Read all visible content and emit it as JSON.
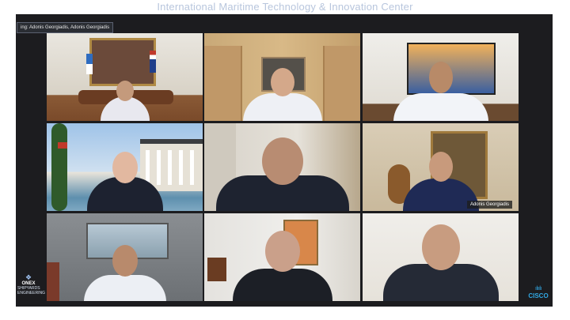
{
  "banner": {
    "title": "International Maritime Technology & Innovation Center"
  },
  "meeting": {
    "speaking_label": "ing: Adonis Georgiadis, Adonis Georgiadis"
  },
  "tiles": [
    {
      "id": 1,
      "name": ""
    },
    {
      "id": 2,
      "name": ""
    },
    {
      "id": 3,
      "name": ""
    },
    {
      "id": 4,
      "name": ""
    },
    {
      "id": 5,
      "name": ""
    },
    {
      "id": 6,
      "name": "Adonis Georgiadis"
    },
    {
      "id": 7,
      "name": ""
    },
    {
      "id": 8,
      "name": ""
    },
    {
      "id": 9,
      "name": ""
    }
  ],
  "branding": {
    "left_logo_glyph": "❖",
    "left_logo_name": "ONEX",
    "left_logo_sub1": "SHIPYARDS",
    "left_logo_sub2": "ENGINEERING",
    "right_logo_bars": "ılıılı",
    "right_logo_name": "CISCO"
  },
  "colors": {
    "active_speaker_outline": "#37a7e6",
    "banner_text": "#b8c6dd",
    "frame_background": "#1c1c1f"
  },
  "icons": {
    "left_logo": "onex-logo-icon",
    "right_logo": "cisco-logo-icon"
  }
}
